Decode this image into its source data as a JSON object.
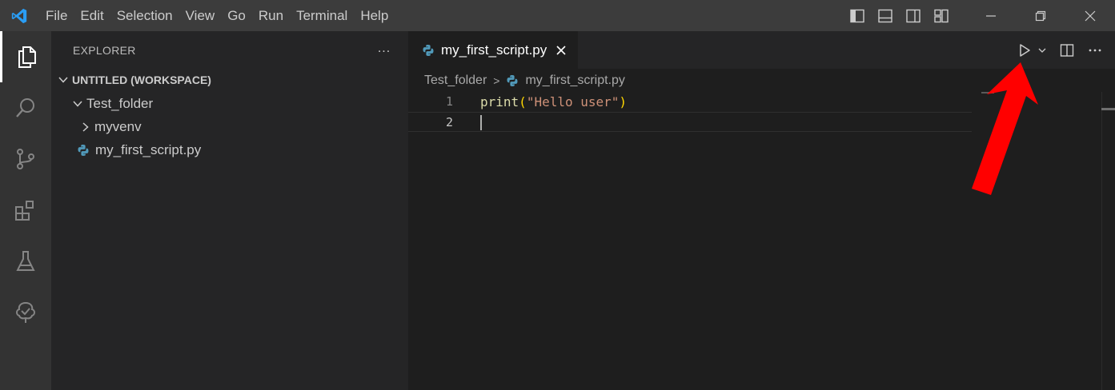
{
  "titlebar": {
    "menu": [
      "File",
      "Edit",
      "Selection",
      "View",
      "Go",
      "Run",
      "Terminal",
      "Help"
    ],
    "layout_icons": [
      "toggle-primary-sidebar-icon",
      "toggle-panel-icon",
      "toggle-secondary-sidebar-icon",
      "customize-layout-icon"
    ],
    "window_controls": [
      "minimize-icon",
      "restore-icon",
      "close-icon"
    ]
  },
  "activitybar": {
    "items": [
      "explorer-icon",
      "search-icon",
      "source-control-icon",
      "extensions-icon",
      "testing-icon",
      "remote-tree-icon"
    ]
  },
  "sidebar": {
    "title": "EXPLORER",
    "more": "...",
    "workspace": "UNTITLED (WORKSPACE)",
    "folder": "Test_folder",
    "subfolder": "myvenv",
    "file": "my_first_script.py"
  },
  "editor": {
    "tab": {
      "label": "my_first_script.py"
    },
    "breadcrumb": {
      "folder": "Test_folder",
      "separator": ">",
      "file": "my_first_script.py"
    },
    "lines": [
      {
        "number": "1",
        "fn": "print",
        "open": "(",
        "str": "\"Hello user\"",
        "close": ")"
      },
      {
        "number": "2",
        "text": ""
      }
    ],
    "actions": [
      "run-python-file-icon",
      "run-dropdown-icon",
      "split-editor-icon",
      "more-actions-icon"
    ]
  },
  "colors": {
    "accent": "#007acc",
    "arrow": "#ff0000",
    "python": "#519aba"
  }
}
